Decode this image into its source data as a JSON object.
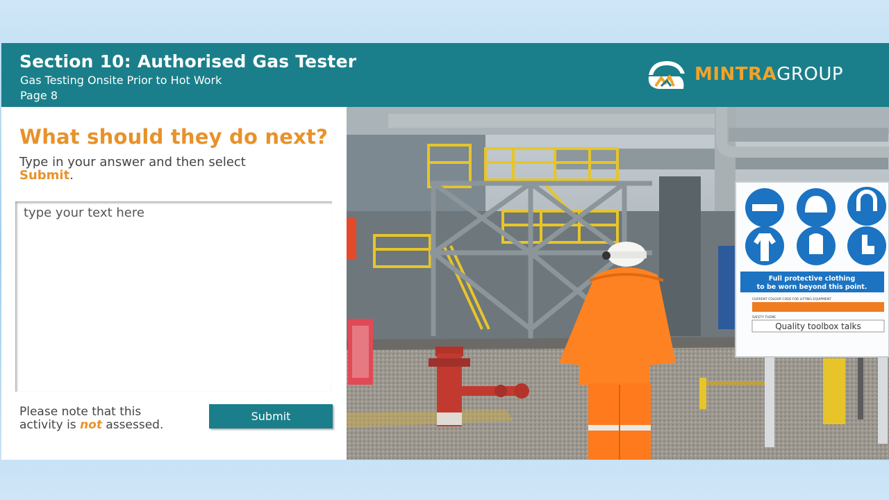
{
  "header": {
    "title": "Section 10: Authorised Gas Tester",
    "subtitle": "Gas Testing Onsite Prior to Hot Work",
    "page_label": "Page 8",
    "logo": {
      "brand_part1": "MINTRA",
      "brand_part2": "GROUP",
      "icon": "mintra-logo-icon"
    }
  },
  "activity": {
    "question": "What should they do next?",
    "instruction_prefix": "Type in your answer and then select",
    "instruction_highlight": "Submit",
    "instruction_suffix": ".",
    "answer_placeholder": "type your text here",
    "answer_value": "",
    "note_line1": "Please note that this",
    "note_prefix": "activity is",
    "note_emphasis": "not",
    "note_suffix": "assessed.",
    "submit_label": "Submit"
  },
  "photo": {
    "sign_line1": "Full protective clothing",
    "sign_line2": "to be worn beyond this point.",
    "sign_colour_code_label": "CURRENT COLOUR CODE FOR LIFTING EQUIPMENT",
    "sign_safety_theme_label": "SAFETY THEME",
    "sign_safety_theme_value": "Quality toolbox talks",
    "sign_icons": [
      "safety-glasses-icon",
      "hard-hat-icon",
      "ear-defenders-icon",
      "coverall-icon",
      "gloves-icon",
      "safety-boots-icon"
    ]
  },
  "colors": {
    "header_bg": "#1a7f8a",
    "accent_orange": "#e8922a",
    "submit_bg": "#1a7f8a"
  }
}
